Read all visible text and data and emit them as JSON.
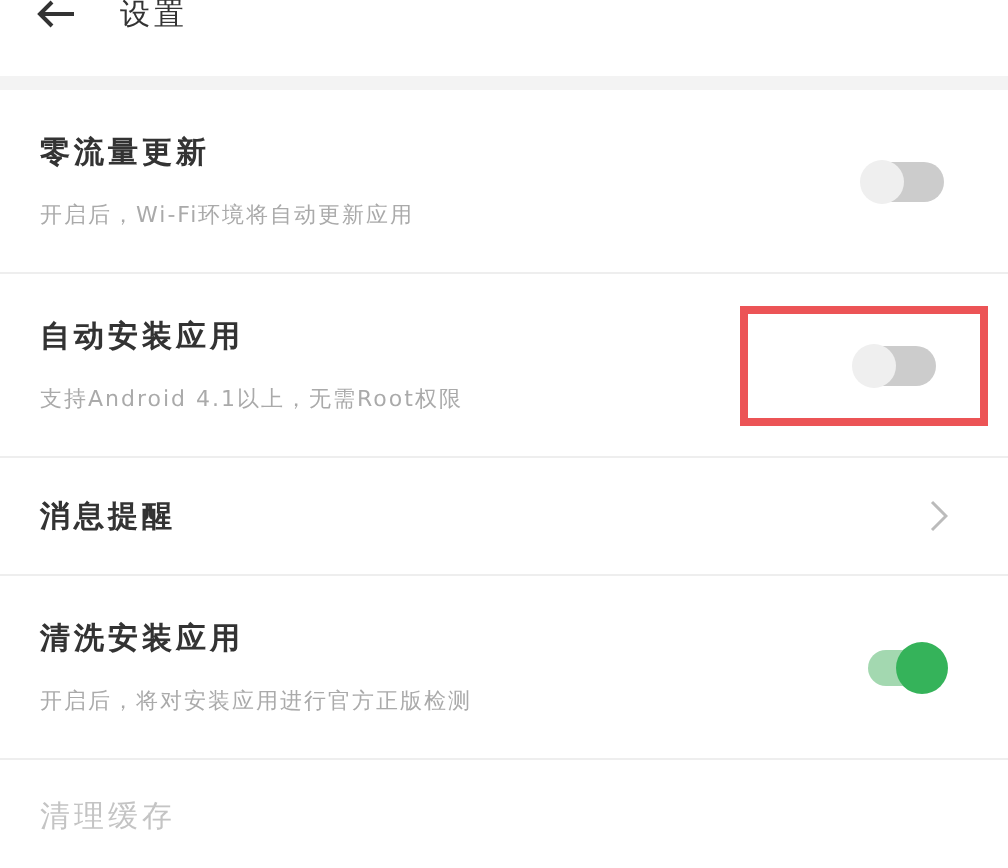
{
  "header": {
    "title": "设置"
  },
  "items": [
    {
      "kind": "toggle",
      "title": "零流量更新",
      "subtitle": "开启后，Wi-Fi环境将自动更新应用",
      "on": false,
      "highlighted": false,
      "disabled": false
    },
    {
      "kind": "toggle",
      "title": "自动安装应用",
      "subtitle": "支持Android 4.1以上，无需Root权限",
      "on": false,
      "highlighted": true,
      "disabled": false
    },
    {
      "kind": "link",
      "title": "消息提醒",
      "highlighted": false,
      "disabled": false
    },
    {
      "kind": "toggle",
      "title": "清洗安装应用",
      "subtitle": "开启后，将对安装应用进行官方正版检测",
      "on": true,
      "highlighted": false,
      "disabled": false
    },
    {
      "kind": "plain",
      "title": "清理缓存",
      "highlighted": false,
      "disabled": true
    }
  ]
}
